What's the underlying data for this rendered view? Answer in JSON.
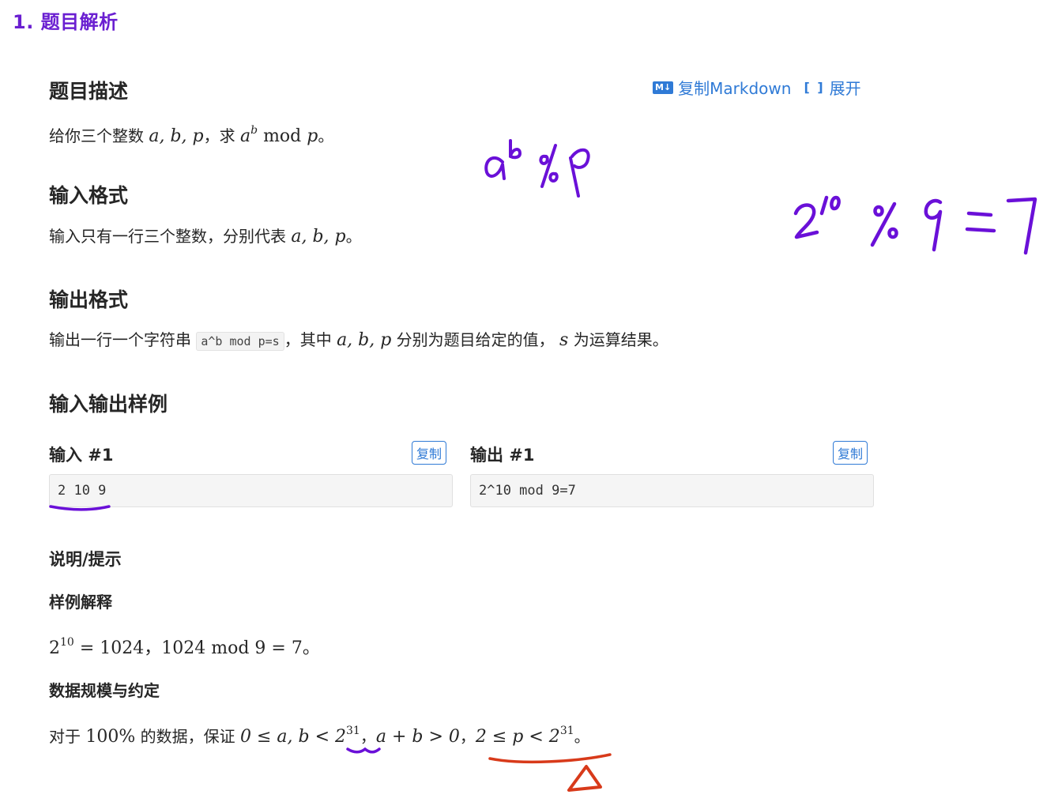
{
  "section_heading": "1. 题目解析",
  "toolbar": {
    "md_icon": "M↓",
    "copy_markdown": "复制Markdown",
    "expand_icon": "[ ]",
    "expand": "展开"
  },
  "description": {
    "title": "题目描述",
    "t1": "给你三个整数 ",
    "vars": "a, b, p",
    "t2": "，求 ",
    "a": "a",
    "b": "b",
    "mod": " mod ",
    "p": "p",
    "end": "。"
  },
  "input_format": {
    "title": "输入格式",
    "t1": "输入只有一行三个整数，分别代表 ",
    "vars": "a, b, p",
    "end": "。"
  },
  "output_format": {
    "title": "输出格式",
    "t1": "输出一行一个字符串 ",
    "code": "a^b mod p=s",
    "t2": "，其中 ",
    "vars": "a, b, p",
    "t3": " 分别为题目给定的值， ",
    "s": "s",
    "t4": " 为运算结果。"
  },
  "samples": {
    "title": "输入输出样例",
    "input_label": "输入 #1",
    "output_label": "输出 #1",
    "copy_label": "复制",
    "input_value": "2 10 9",
    "output_value": "2^10 mod 9=7"
  },
  "hints": {
    "title": "说明/提示",
    "example_title": "样例解释",
    "ex_base": "2",
    "ex_exp": "10",
    "ex_rest": " = 1024，1024 mod 9 = 7。",
    "scale_title": "数据规模与约定",
    "c1": "对于 ",
    "c2": "100%",
    "c3": " 的数据，保证 ",
    "c4": "0 ≤ a, b < 2",
    "exp31": "31",
    "c5": "，",
    "c6": "a + b > 0",
    "c7": "，",
    "c8": "2 ≤ p < 2",
    "c9": "。"
  },
  "annotations": {
    "note1": "a^b %p",
    "note2": "2^10 % 9 = 7",
    "pen_purple": "#6a10d8",
    "pen_red": "#d83a1a"
  }
}
